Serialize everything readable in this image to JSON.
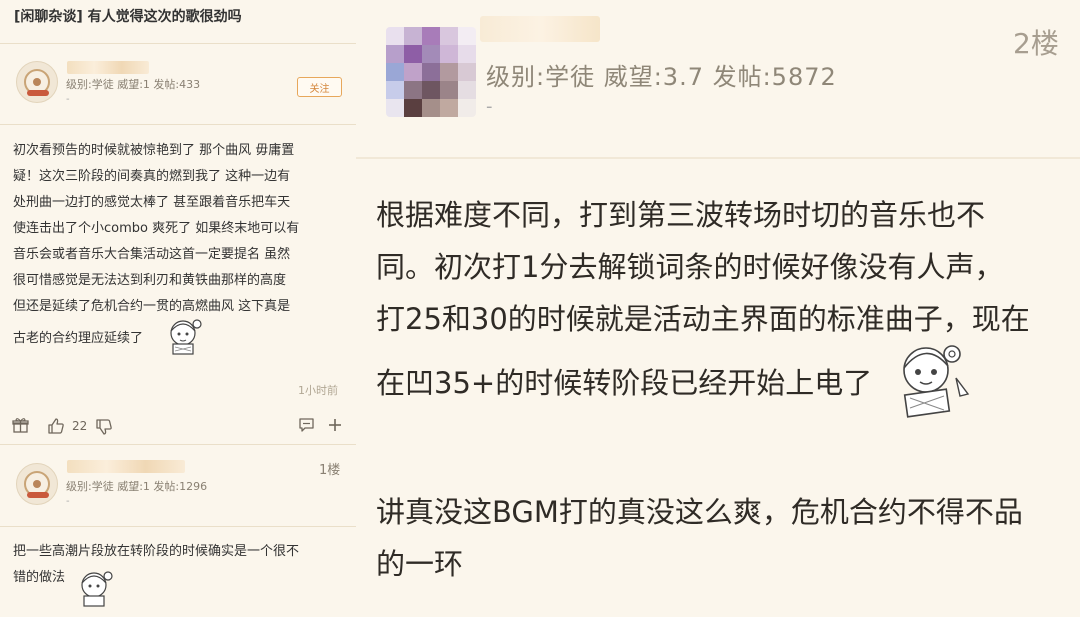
{
  "left": {
    "thread_title": "[闲聊杂谈] 有人觉得这次的歌很劲吗",
    "op": {
      "meta": "级别:学徒  威望:1  发帖:433",
      "dash": "-",
      "follow_label": "关注",
      "body": [
        "初次看预告的时候就被惊艳到了 那个曲风 毋庸置",
        "疑！这次三阶段的间奏真的燃到我了 这种一边有",
        "处刑曲一边打的感觉太棒了 甚至跟着音乐把车天",
        "使连击出了个小combo 爽死了 如果终末地可以有",
        "音乐会或者音乐大合集活动这首一定要提名 虽然",
        "很可惜感觉是无法达到利刃和黄铁曲那样的高度",
        "但还是延续了危机合约一贯的高燃曲风 这下真是",
        "古老的合约理应延续了"
      ],
      "time": "1小时前",
      "like_count": "22"
    },
    "reply": {
      "floor": "1楼",
      "meta": "级别:学徒  威望:1  发帖:1296",
      "dash": "-",
      "body": [
        "把一些高潮片段放在转阶段的时候确实是一个很不",
        "错的做法"
      ]
    }
  },
  "right": {
    "floor": "2楼",
    "meta": "级别:学徒  威望:3.7  发帖:5872",
    "dash": "-",
    "body": [
      "根据难度不同，打到第三波转场时切的音乐也不",
      "同。初次打1分去解锁词条的时候好像没有人声，",
      "打25和30的时候就是活动主界面的标准曲子，现在",
      "在凹35+的时候转阶段已经开始上电了"
    ],
    "body2": [
      "讲真没这BGM打的真没这么爽，危机合约不得不品",
      "的一环"
    ]
  },
  "icons": {
    "gift": "gift-icon",
    "thumb_up": "thumb-up-icon",
    "thumb_down": "thumb-down-icon",
    "comment": "comment-icon",
    "plus": "plus-icon"
  },
  "colors": {
    "panel_bg": "#fbf6ec",
    "accent": "#e7a75b",
    "text": "#333333",
    "meta": "#8a8173"
  }
}
